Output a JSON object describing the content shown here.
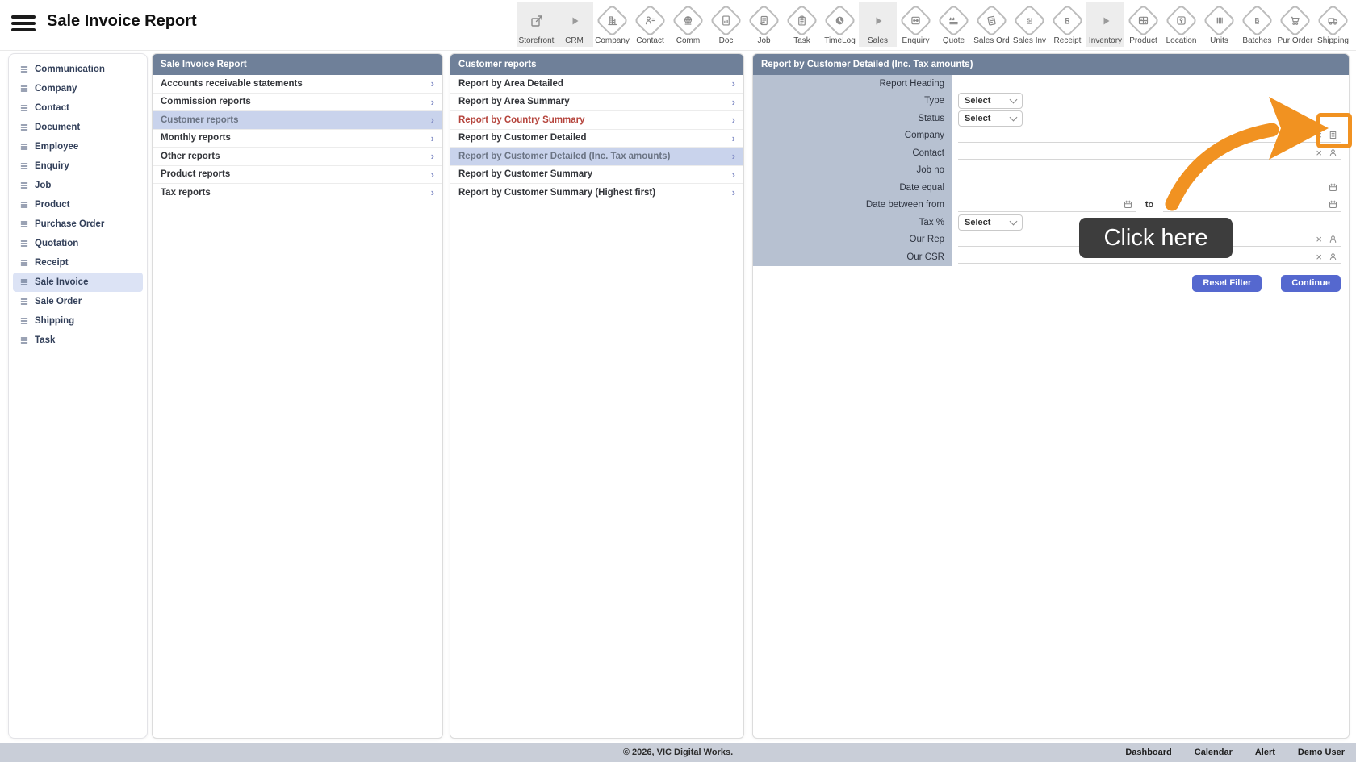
{
  "topbar": {
    "title": "Sale Invoice Report"
  },
  "toolbar": {
    "items": [
      {
        "label": "Storefront",
        "icon": "external-link",
        "group": true
      },
      {
        "label": "CRM",
        "icon": "play",
        "group": true
      },
      {
        "label": "Company",
        "icon": "building"
      },
      {
        "label": "Contact",
        "icon": "person-card"
      },
      {
        "label": "Comm",
        "icon": "globe"
      },
      {
        "label": "Doc",
        "icon": "doc-chart"
      },
      {
        "label": "Job",
        "icon": "doc-check"
      },
      {
        "label": "Task",
        "icon": "clipboard"
      },
      {
        "label": "TimeLog",
        "icon": "clock"
      },
      {
        "label": "Sales",
        "icon": "play",
        "group": true
      },
      {
        "label": "Enquiry",
        "icon": "binoculars"
      },
      {
        "label": "Quote",
        "icon": "quote"
      },
      {
        "label": "Sales Ord",
        "icon": "note"
      },
      {
        "label": "Sales Inv",
        "icon": "si"
      },
      {
        "label": "Receipt",
        "icon": "r"
      },
      {
        "label": "Inventory",
        "icon": "play",
        "group": true
      },
      {
        "label": "Product",
        "icon": "shelf"
      },
      {
        "label": "Location",
        "icon": "map-pin"
      },
      {
        "label": "Units",
        "icon": "barcode"
      },
      {
        "label": "Batches",
        "icon": "b"
      },
      {
        "label": "Pur Order",
        "icon": "cart"
      },
      {
        "label": "Shipping",
        "icon": "truck"
      }
    ]
  },
  "sidebar": {
    "items": [
      {
        "label": "Communication"
      },
      {
        "label": "Company"
      },
      {
        "label": "Contact"
      },
      {
        "label": "Document"
      },
      {
        "label": "Employee"
      },
      {
        "label": "Enquiry"
      },
      {
        "label": "Job"
      },
      {
        "label": "Product"
      },
      {
        "label": "Purchase Order"
      },
      {
        "label": "Quotation"
      },
      {
        "label": "Receipt"
      },
      {
        "label": "Sale Invoice",
        "active": true
      },
      {
        "label": "Sale Order"
      },
      {
        "label": "Shipping"
      },
      {
        "label": "Task"
      }
    ]
  },
  "report_panel": {
    "title": "Sale Invoice Report",
    "items": [
      {
        "label": "Accounts receivable statements"
      },
      {
        "label": "Commission reports"
      },
      {
        "label": "Customer reports",
        "selected": true
      },
      {
        "label": "Monthly reports"
      },
      {
        "label": "Other reports"
      },
      {
        "label": "Product reports"
      },
      {
        "label": "Tax reports"
      }
    ]
  },
  "customer_panel": {
    "title": "Customer reports",
    "items": [
      {
        "label": "Report by Area Detailed"
      },
      {
        "label": "Report by Area Summary"
      },
      {
        "label": "Report by Country Summary",
        "danger": true
      },
      {
        "label": "Report by Customer Detailed"
      },
      {
        "label": "Report by Customer Detailed (Inc. Tax amounts)",
        "selected": true
      },
      {
        "label": "Report by Customer Summary"
      },
      {
        "label": "Report by Customer Summary (Highest first)"
      }
    ]
  },
  "detail_panel": {
    "title": "Report by Customer Detailed (Inc. Tax amounts)",
    "fields": [
      {
        "label": "Report Heading",
        "type": "text"
      },
      {
        "label": "Type",
        "type": "select",
        "value": "Select"
      },
      {
        "label": "Status",
        "type": "select",
        "value": "Select"
      },
      {
        "label": "Company",
        "type": "picker",
        "picker_icon": "company",
        "highlighted": true
      },
      {
        "label": "Contact",
        "type": "picker",
        "picker_icon": "person"
      },
      {
        "label": "Job no",
        "type": "text"
      },
      {
        "label": "Date equal",
        "type": "date"
      },
      {
        "label": "Date between from",
        "type": "daterange",
        "separator": "to"
      },
      {
        "label": "Tax %",
        "type": "select",
        "value": "Select"
      },
      {
        "label": "Our Rep",
        "type": "picker",
        "picker_icon": "person"
      },
      {
        "label": "Our CSR",
        "type": "picker",
        "picker_icon": "person"
      }
    ],
    "buttons": {
      "reset": "Reset Filter",
      "continue": "Continue"
    }
  },
  "annotation": {
    "tooltip": "Click here"
  },
  "footer": {
    "copyright": "© 2026, VIC Digital Works.",
    "links": [
      "Dashboard",
      "Calendar",
      "Alert",
      "Demo User"
    ]
  },
  "colors": {
    "accent_orange": "#F19221",
    "header_slate": "#6F8099",
    "selected_row": "#C9D3EC",
    "label_column": "#B7C1D1",
    "danger_text": "#B5443C",
    "button_blue": "#5568CF",
    "footer_bg": "#C9CED8"
  }
}
